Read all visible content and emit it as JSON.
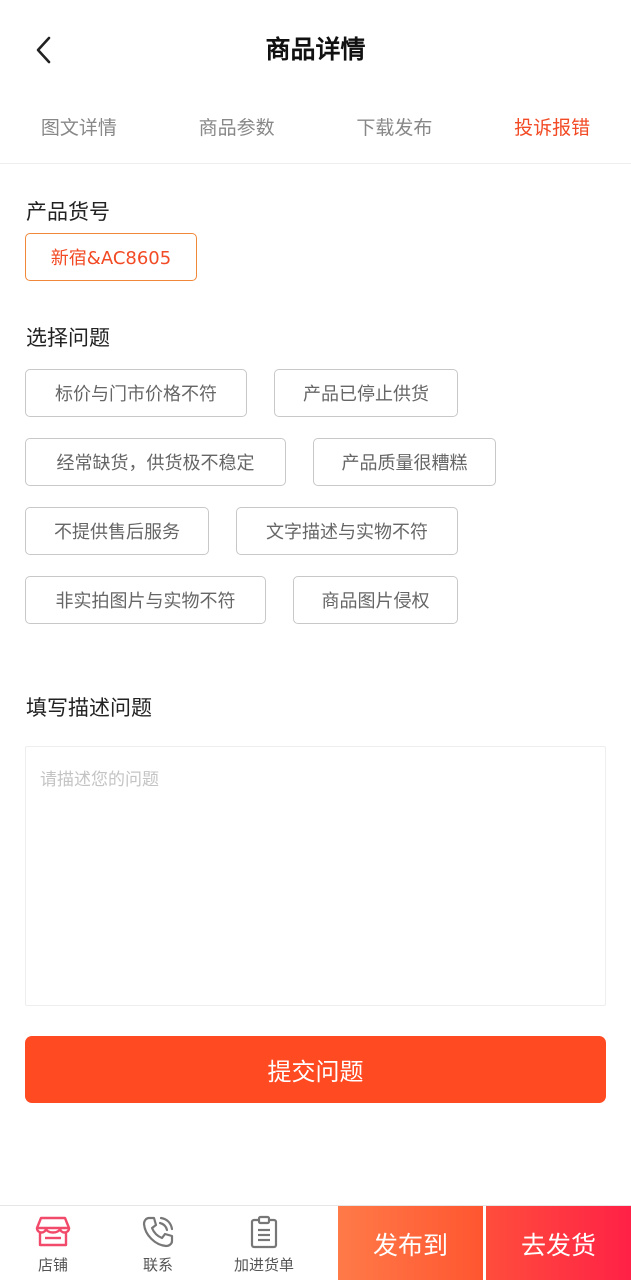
{
  "header": {
    "title": "商品详情",
    "back_icon": "chevron-left-icon"
  },
  "tabs": [
    {
      "label": "图文详情",
      "active": false
    },
    {
      "label": "商品参数",
      "active": false
    },
    {
      "label": "下载发布",
      "active": false
    },
    {
      "label": "投诉报错",
      "active": true
    }
  ],
  "product": {
    "sku_label": "产品货号",
    "sku_value": "新宿&AC8605"
  },
  "issues": {
    "label": "选择问题",
    "options": [
      "标价与门市价格不符",
      "产品已停止供货",
      "经常缺货，供货极不稳定",
      "产品质量很糟糕",
      "不提供售后服务",
      "文字描述与实物不符",
      "非实拍图片与实物不符",
      "商品图片侵权"
    ]
  },
  "description": {
    "label": "填写描述问题",
    "placeholder": "请描述您的问题",
    "value": ""
  },
  "submit_label": "提交问题",
  "bottom_nav": {
    "items": [
      {
        "label": "店铺",
        "icon": "store-icon"
      },
      {
        "label": "联系",
        "icon": "phone-icon"
      },
      {
        "label": "加进货单",
        "icon": "clipboard-list-icon"
      }
    ],
    "publish_label": "发布到",
    "ship_label": "去发货"
  },
  "colors": {
    "accent": "#f24a24",
    "submit": "#ff4a22",
    "store_icon": "#f24a6a"
  }
}
